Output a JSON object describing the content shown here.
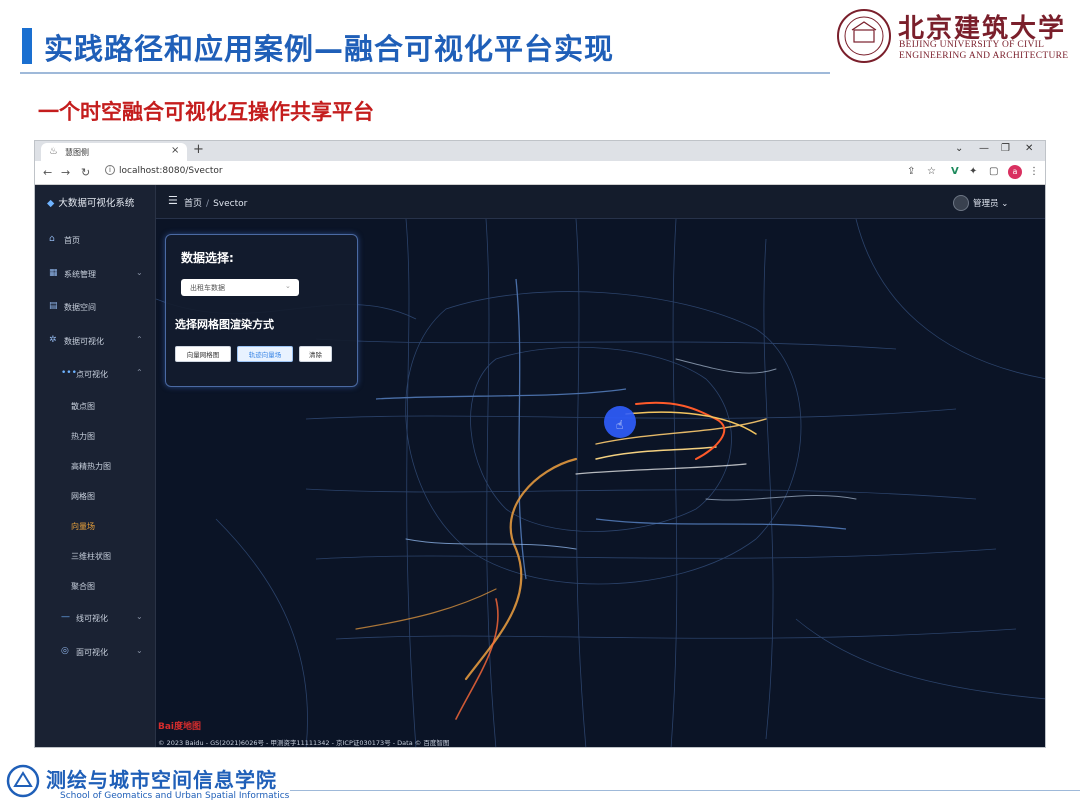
{
  "slide": {
    "title": "实践路径和应用案例—融合可视化平台实现",
    "subtitle": "一个时空融合可视化互操作共享平台",
    "university_cn": "北京建筑大学",
    "university_en_line1": "BEIJING UNIVERSITY OF CIVIL",
    "university_en_line2": "ENGINEERING AND ARCHITECTURE",
    "footer_cn": "测绘与城市空间信息学院",
    "footer_en": "School of Geomatics and Urban Spatial Informatics",
    "accent_color": "#1f5fb8",
    "subtitle_color": "#c41d1d"
  },
  "browser": {
    "tab_title": "慧图侧",
    "url": "localhost:8080/Svector"
  },
  "app": {
    "brand": "大数据可视化系统",
    "sidebar": {
      "items": [
        {
          "label": "首页",
          "icon": "home-icon"
        },
        {
          "label": "系统管理",
          "icon": "grid-icon"
        },
        {
          "label": "数据空间",
          "icon": "doc-icon"
        },
        {
          "label": "数据可视化",
          "icon": "chart-icon"
        },
        {
          "label": "点可视化",
          "icon": "dots-icon"
        }
      ],
      "sub_items": [
        "散点图",
        "热力图",
        "高精热力图",
        "网格图",
        "向量场",
        "三维柱状图",
        "聚合图"
      ],
      "active_sub": "向量场",
      "more_items": [
        {
          "label": "线可视化",
          "icon": "line-icon"
        },
        {
          "label": "面可视化",
          "icon": "polygon-icon"
        }
      ]
    },
    "breadcrumb": {
      "home": "首页",
      "sep": "/",
      "current": "Svector"
    },
    "user": "管理员",
    "panel": {
      "data_heading": "数据选择:",
      "select_value": "出租车数据",
      "render_heading": "选择网格图渲染方式",
      "buttons": [
        "向量网格图",
        "轨迹向量场",
        "清除"
      ]
    },
    "map": {
      "logo": "Bai度地图",
      "copyright": "© 2023 Baidu - GS(2021)6026号 - 甲测资字11111342 - 京ICP证030173号 - Data © 百度智图"
    }
  }
}
